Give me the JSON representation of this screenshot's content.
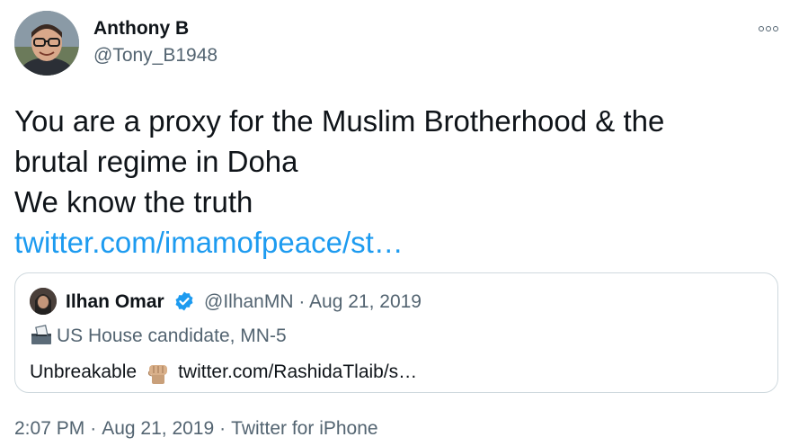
{
  "author": {
    "display_name": "Anthony B",
    "handle": "@Tony_B1948",
    "avatar_icon": "profile-photo"
  },
  "tweet": {
    "text_lines": [
      "You are a proxy for the Muslim Brotherhood & the",
      "brutal regime in Doha",
      "We know the truth"
    ],
    "link": "twitter.com/imamofpeace/st…"
  },
  "quoted_tweet": {
    "display_name": "Ilhan Omar",
    "verified": true,
    "handle": "@IlhanMN",
    "separator": "·",
    "date": "Aug 21, 2019",
    "bio_icon": "ballot-box-icon",
    "bio": "US House candidate, MN-5",
    "body_text": "Unbreakable",
    "body_emoji": "raised-fist",
    "body_link": "twitter.com/RashidaTlaib/s…"
  },
  "footer": {
    "time": "2:07 PM",
    "separator": "·",
    "date": "Aug 21, 2019",
    "source": "Twitter for iPhone"
  },
  "colors": {
    "link": "#1d9bf0",
    "secondary_text": "#536471",
    "primary_text": "#0f1419",
    "border": "#cfd9de"
  }
}
